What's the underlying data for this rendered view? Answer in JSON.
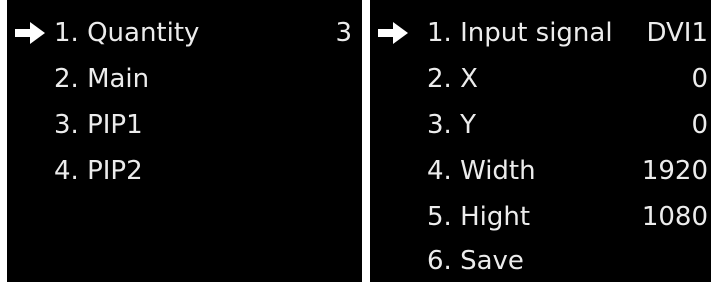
{
  "left_menu": {
    "items": [
      {
        "label": "1. Quantity",
        "value": "3",
        "selected": true
      },
      {
        "label": "2. Main",
        "value": "",
        "selected": false
      },
      {
        "label": "3. PIP1",
        "value": "",
        "selected": false
      },
      {
        "label": "4. PIP2",
        "value": "",
        "selected": false
      }
    ]
  },
  "right_menu": {
    "items": [
      {
        "label": "1. Input signal",
        "value": "DVI1",
        "selected": true
      },
      {
        "label": "2. X",
        "value": "0",
        "selected": false
      },
      {
        "label": "3. Y",
        "value": "0",
        "selected": false
      },
      {
        "label": "4. Width",
        "value": "1920",
        "selected": false
      },
      {
        "label": "5. Hight",
        "value": "1080",
        "selected": false
      },
      {
        "label": "6. Save",
        "value": "",
        "selected": false
      }
    ]
  },
  "icons": {
    "pointer": "arrow-right-icon"
  },
  "colors": {
    "screen_background": "#000000",
    "text": "#ececec",
    "pointer": "#ffffff",
    "page_background": "#ffffff"
  }
}
